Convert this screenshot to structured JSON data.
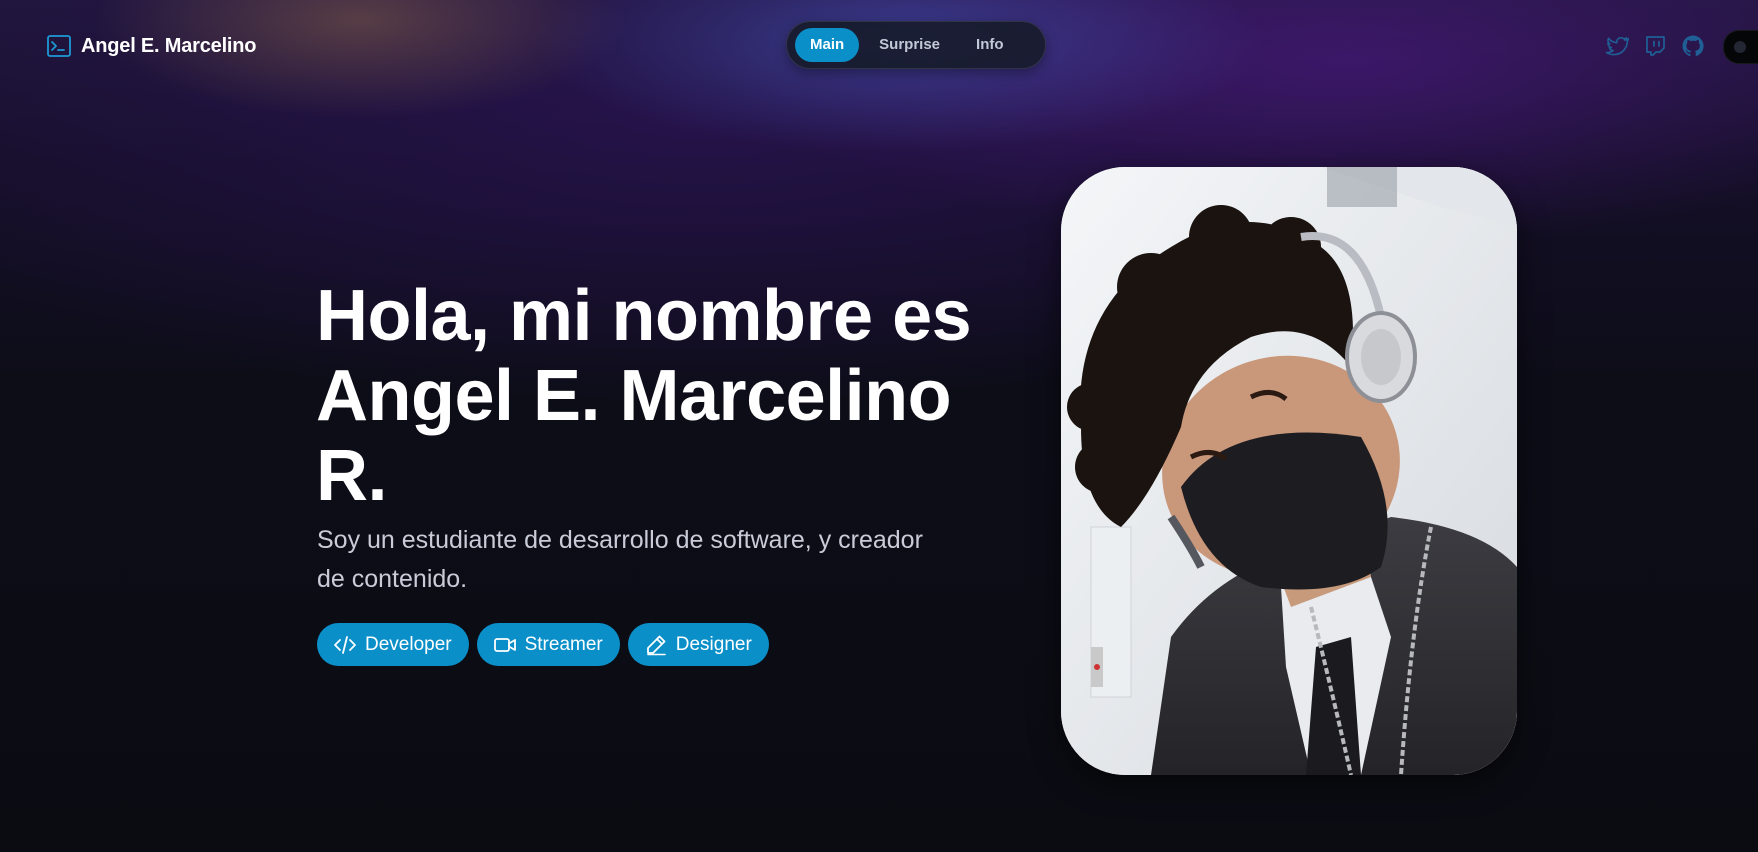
{
  "brand": {
    "name": "Angel E. Marcelino",
    "icon": "terminal-icon"
  },
  "nav": {
    "tabs": [
      {
        "label": "Main",
        "active": true
      },
      {
        "label": "Surprise",
        "active": false
      },
      {
        "label": "Info",
        "active": false
      }
    ]
  },
  "socials": {
    "icons": [
      "twitter-icon",
      "twitch-icon",
      "github-icon"
    ]
  },
  "theme_toggle": {
    "icon": "theme-toggle-icon"
  },
  "hero": {
    "title_lines": [
      "Hola, mi nombre es",
      "Angel E. Marcelino",
      "R."
    ],
    "subtitle": "Soy un estudiante de desarrollo de software, y creador de contenido.",
    "tags": [
      {
        "label": "Developer",
        "icon": "code-icon"
      },
      {
        "label": "Streamer",
        "icon": "video-camera-icon"
      },
      {
        "label": "Designer",
        "icon": "pencil-icon"
      }
    ]
  },
  "photo": {
    "description": "profile-photo"
  },
  "colors": {
    "accent": "#0b8fc9",
    "background": "#0b0c12",
    "nav_bg": "#161a28",
    "social_icon": "#1f5f96",
    "text_secondary": "#c9ccd8"
  }
}
